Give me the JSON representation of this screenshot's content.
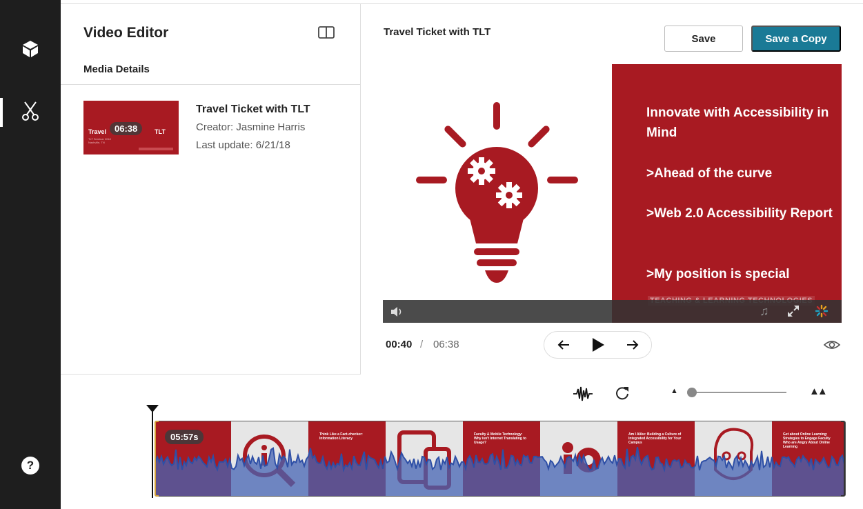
{
  "editor": {
    "title": "Video Editor",
    "media_section_label": "Media Details"
  },
  "media": {
    "name": "Travel Ticket with TLT",
    "creator": "Creator: Jasmine Harris",
    "last_update": "Last update: 6/21/18",
    "thumbnail_duration": "06:38",
    "thumbnail_title_left": "Travel",
    "thumbnail_title_right": "TLT",
    "thumbnail_subtitle": "TLT Seminar 2018 Nashville, TN"
  },
  "video": {
    "title": "Travel Ticket with TLT",
    "save_label": "Save",
    "save_copy_label": "Save a Copy",
    "slide_lines": [
      "Innovate with Accessibility in Mind",
      ">Ahead of the curve",
      ">Web 2.0 Accessibility Report",
      ">My position is special"
    ],
    "slide_footer": "TEACHING & LEARNING TECHNOLOGIES",
    "current_time": "00:40",
    "time_separator": "/",
    "total_time": "06:38"
  },
  "timeline": {
    "position_badge": "05:57s",
    "zoom_level": 0.02,
    "frame_captions": [
      "Think Like a Fact-checker: Information Literacy",
      "Faculty & Mobile Technology: Why isn't Internet Translating to Usage?",
      "Am I Alike: Building a Culture of Integrated Accessibility for Your Campus",
      "Get about Online Learning: Strategies to Engage Faculty Who are Angry About Online Learning"
    ]
  },
  "icons": {
    "rail_top": "cube-icon",
    "rail_active": "scissors-icon",
    "rail_help": "help-icon"
  },
  "colors": {
    "rail_bg": "#1e1e1e",
    "brand_red": "#a81a22",
    "primary_button": "#1a7a96",
    "waveform": "#2e4fa6"
  }
}
